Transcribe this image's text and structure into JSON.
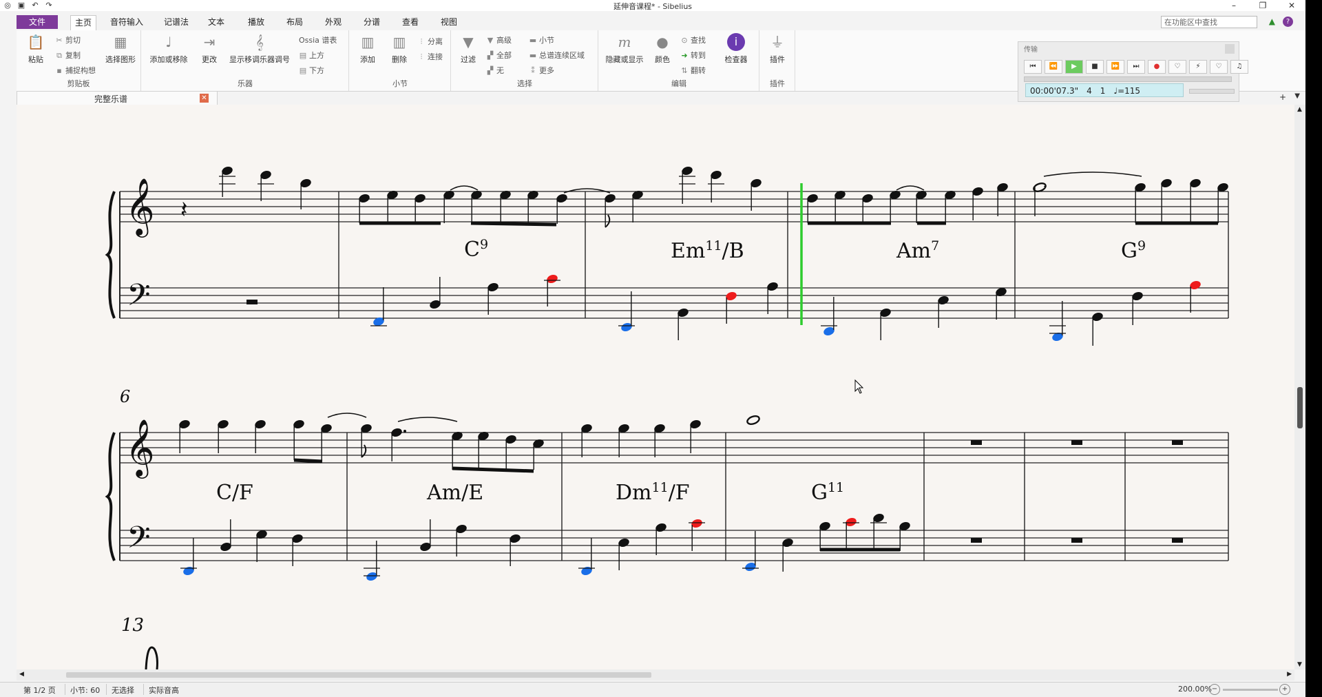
{
  "window": {
    "title": "延伸音课程* - Sibelius",
    "minimize": "–",
    "restore": "❐",
    "close": "✕"
  },
  "quick_access": [
    "save-icon",
    "undo-icon",
    "redo-icon"
  ],
  "menu": {
    "file_tab": "文件",
    "tabs": [
      "主页",
      "音符输入",
      "记谱法",
      "文本",
      "播放",
      "布局",
      "外观",
      "分谱",
      "查看",
      "视图"
    ],
    "active_tab": "主页",
    "search_placeholder": "在功能区中查找"
  },
  "ribbon": {
    "clipboard": {
      "label": "剪贴板",
      "paste": "粘贴",
      "cut": "剪切",
      "copy": "复制",
      "capture": "捕捉构想",
      "select_graphic": "选择图形"
    },
    "instruments": {
      "label": "乐器",
      "add_remove": "添加或移除",
      "change": "更改",
      "transpose": "显示移调乐器调号",
      "ossia": "Ossia 谱表",
      "above": "上方",
      "below": "下方"
    },
    "bars": {
      "label": "小节",
      "add": "添加",
      "delete": "删除",
      "split": "分离",
      "join": "连接"
    },
    "selection": {
      "label": "选择",
      "filter": "过滤",
      "advanced": "高级",
      "all": "全部",
      "none": "无",
      "bar": "小节",
      "system_passage": "总谱连续区域",
      "more": "更多"
    },
    "edit": {
      "label": "编辑",
      "hide_show": "隐藏或显示",
      "color": "颜色",
      "find": "查找",
      "go_to": "转到",
      "flip": "翻转",
      "inspector": "检查器"
    },
    "plugins": {
      "label": "插件",
      "plugins": "插件"
    }
  },
  "transport": {
    "title": "传输",
    "time": "00:00'07.3\"",
    "bar": "4",
    "beat": "1",
    "tempo": "♩=115"
  },
  "document_tab": "完整乐谱",
  "score": {
    "system2_number": "6",
    "system3_number": "13",
    "chords_system1": [
      {
        "name": "chord-c9",
        "root": "C",
        "ext": "9"
      },
      {
        "name": "chord-em11b",
        "root": "Em",
        "ext": "11",
        "tail": "/B"
      },
      {
        "name": "chord-am7",
        "root": "Am",
        "ext": "7"
      },
      {
        "name": "chord-g9",
        "root": "G",
        "ext": "9"
      }
    ],
    "chords_system2": [
      {
        "name": "chord-cf",
        "root": "C/F",
        "ext": ""
      },
      {
        "name": "chord-ame",
        "root": "Am/E",
        "ext": ""
      },
      {
        "name": "chord-dm11f",
        "root": "Dm",
        "ext": "11",
        "tail": "/F"
      },
      {
        "name": "chord-g11",
        "root": "G",
        "ext": "11"
      }
    ],
    "colors": {
      "blue": "#1a6ee8",
      "red": "#ee1c1c",
      "playline": "#2ecc2e",
      "black": "#111111"
    }
  },
  "status": {
    "page": "第 1/2 页",
    "bar": "小节: 60",
    "selection": "无选择",
    "pitch": "实际音高",
    "zoom": "200.00%"
  }
}
